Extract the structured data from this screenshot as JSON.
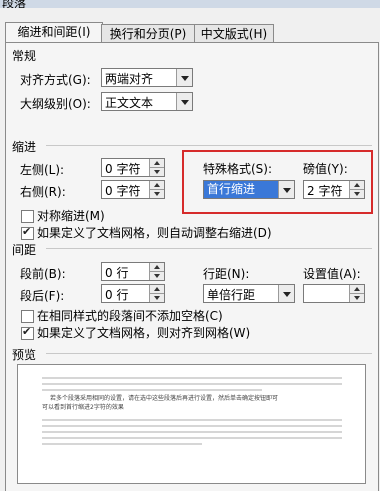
{
  "window": {
    "title_fragment": "段落"
  },
  "tabs": [
    {
      "label": "缩进和间距(I)",
      "active": true
    },
    {
      "label": "换行和分页(P)",
      "active": false
    },
    {
      "label": "中文版式(H)",
      "active": false
    }
  ],
  "general": {
    "heading": "常规",
    "alignment_label": "对齐方式(G):",
    "alignment_value": "两端对齐",
    "outline_label": "大纲级别(O):",
    "outline_value": "正文文本"
  },
  "indent": {
    "heading": "缩进",
    "left_label": "左侧(L):",
    "left_value": "0 字符",
    "right_label": "右侧(R):",
    "right_value": "0 字符",
    "special_label": "特殊格式(S):",
    "special_value": "首行缩进",
    "by_label": "磅值(Y):",
    "by_value": "2 字符",
    "mirror_label": "对称缩进(M)",
    "mirror_checked": false,
    "auto_right_label": "如果定义了文档网格，则自动调整右缩进(D)",
    "auto_right_checked": true
  },
  "spacing": {
    "heading": "间距",
    "before_label": "段前(B):",
    "before_value": "0 行",
    "after_label": "段后(F):",
    "after_value": "0 行",
    "line_label": "行距(N):",
    "line_value": "单倍行距",
    "at_label": "设置值(A):",
    "at_value": "",
    "no_space_label": "在相同样式的段落间不添加空格(C)",
    "no_space_checked": false,
    "snap_grid_label": "如果定义了文档网格，则对齐到网格(W)",
    "snap_grid_checked": true
  },
  "preview": {
    "heading": "预览",
    "sample_line1": "若多个段落采用相同的设置，请在选中这些段落后再进行设置，然后单击确定按钮即可",
    "sample_line2": "可以看到首行缩进2字符的效果"
  },
  "colors": {
    "highlight": "#d62b2b",
    "selection": "#3a78d8"
  }
}
